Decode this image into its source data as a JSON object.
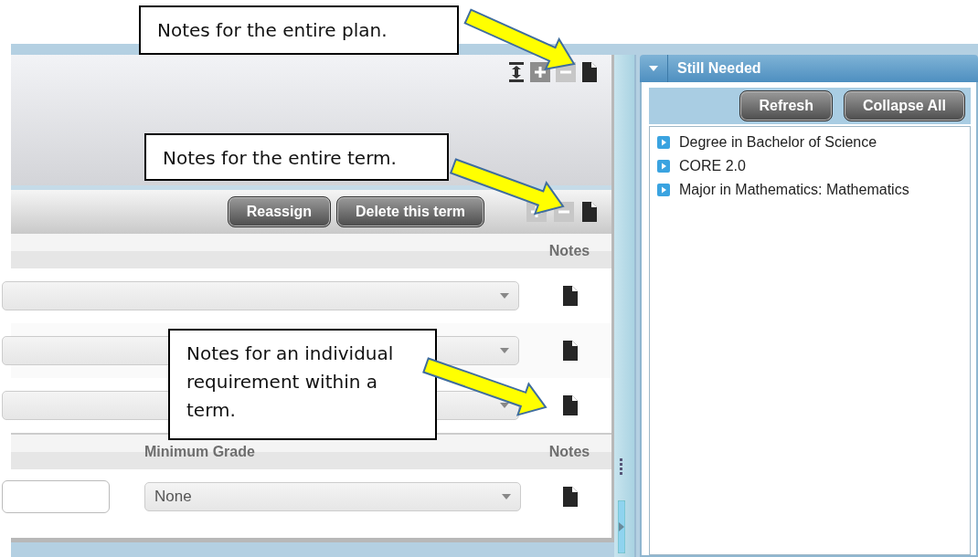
{
  "plan_toolbar": {
    "add_disabled": false,
    "remove_disabled": true
  },
  "term": {
    "buttons": [
      "Reassign",
      "Delete this term"
    ],
    "add_disabled": true,
    "remove_disabled": true
  },
  "requirements": {
    "columns": [
      "Notes"
    ],
    "rows": [
      {
        "kind": "dropdown"
      },
      {
        "kind": "dropdown"
      },
      {
        "kind": "dropdown"
      }
    ]
  },
  "grade_table": {
    "columns": [
      "Minimum Grade",
      "Notes"
    ],
    "rows": [
      {
        "grade": "None"
      }
    ]
  },
  "still_needed": {
    "title": "Still Needed",
    "expanded": true,
    "buttons": [
      "Refresh",
      "Collapse All"
    ],
    "items": [
      {
        "label": "Degree in Bachelor of Science"
      },
      {
        "label": "CORE 2.0"
      },
      {
        "label": "Major in Mathematics: Mathematics"
      }
    ]
  },
  "callouts": [
    {
      "text": "Notes for the entire plan."
    },
    {
      "text": "Notes for the entire term."
    },
    {
      "text": "Notes for an individual requirement within a term."
    }
  ]
}
